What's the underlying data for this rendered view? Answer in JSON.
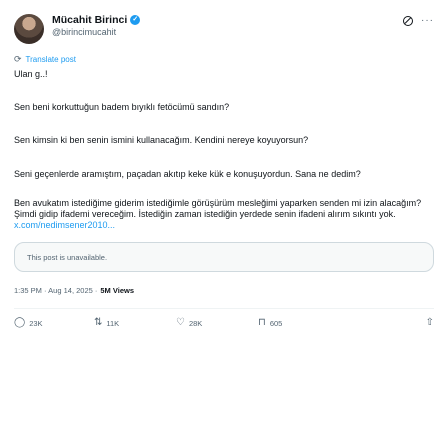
{
  "author": {
    "display_name": "Mücahit Birinci",
    "handle": "@birincimucahit"
  },
  "icons": {
    "verified": "verified-badge-icon",
    "grok": "grok-icon",
    "more": "more-icon",
    "translate": "translate-icon",
    "reply": "reply-icon",
    "repost": "repost-icon",
    "like": "like-icon",
    "bookmark": "bookmark-icon",
    "share": "share-icon"
  },
  "colors": {
    "accent": "#1d9bf0",
    "text": "#0f1419",
    "muted": "#536471"
  },
  "translate_label": "Translate post",
  "post": {
    "p1": "Ulan g..!",
    "p2": "Sen beni korkuttuğun badem bıyıklı fetöcümü sandın?",
    "p3": "Sen kimsin ki ben senin ismini kullanacağım. Kendini nereye koyuyorsun?",
    "p4": "Seni geçenlerde aramıştım, paçadan akıtıp keke kük e konuşuyordun. Sana ne dedim?",
    "p5_text": "Ben avukatım istediğime giderim istediğimle görüşürüm mesleğimi yaparken senden mi izin alacağım? Şimdi gidip ifademi vereceğim. İstediğin zaman istediğin yerdede senin ifadeni alırım sıkıntı yok.",
    "p5_link": "x.com/nedimsener2010..."
  },
  "quote_unavailable": "This post is unavailable.",
  "meta": {
    "time_date": "1:35 PM · Aug 14, 2025 ·",
    "views": "5M Views"
  },
  "actions": {
    "replies": "23K",
    "reposts": "11K",
    "likes": "28K",
    "bookmarks": "605"
  }
}
